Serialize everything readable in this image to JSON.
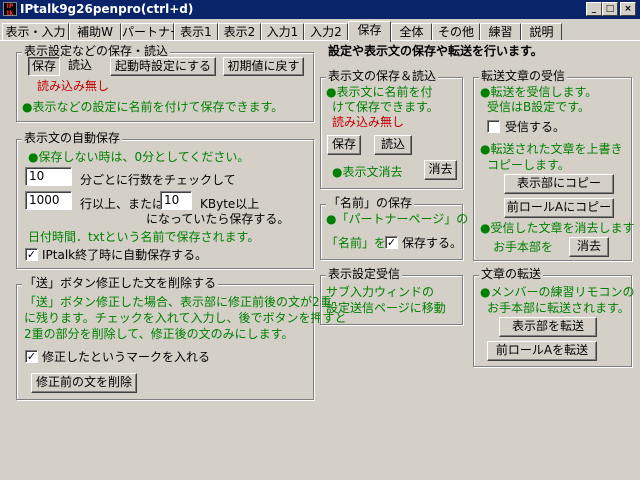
{
  "window": {
    "title": "IPtalk9g26penpro(ctrl+d)",
    "icon_label": "IPtalk"
  },
  "tabs": [
    "表示・入力",
    "補助W",
    "パートナー",
    "表示1",
    "表示2",
    "入力1",
    "入力2",
    "保存",
    "全体",
    "その他",
    "練習",
    "説明"
  ],
  "active_tab": "保存",
  "heading": "設定や表示文の保存や転送を行います。",
  "settings_save": {
    "title": "表示設定などの保存・読込",
    "save": "保存",
    "load": "読込",
    "startup": "起動時設定にする",
    "reset": "初期値に戻す",
    "status": "読み込み無し",
    "note": "●表示などの設定に名前を付けて保存できます。"
  },
  "autosave": {
    "title": "表示文の自動保存",
    "note1": "●保存しない時は、0分としてください。",
    "minutes": "10",
    "minutes_label": "分ごとに行数をチェックして",
    "lines": "1000",
    "lines_label": "行以上、または",
    "kbyte": "10",
    "kbyte_label": "KByte以上",
    "line3": "になっていたら保存する。",
    "note2": "日付時間．txtという名前で保存されます。",
    "on_exit": "IPtalk終了時に自動保存する。"
  },
  "send_fix": {
    "title": "「送」ボタン修正した文を削除する",
    "desc1": "「送」ボタン修正した場合、表示部に修正前後の文が2重",
    "desc2": "に残ります。チェックを入れて入力し、後でボタンを押すと",
    "desc3": "2重の部分を削除して、修正後の文のみにします。",
    "mark_label": "修正したというマークを入れる",
    "delete_button": "修正前の文を削除"
  },
  "text_save": {
    "title": "表示文の保存＆読込",
    "note1": "●表示文に名前を付",
    "note2": "けて保存できます。",
    "status": "読み込み無し",
    "save": "保存",
    "load": "読込",
    "clear_label": "●表示文消去",
    "clear": "消去"
  },
  "name_save": {
    "title": "「名前」の保存",
    "line1": "●「パートナーページ」の",
    "line2": "「名前」を",
    "check_label": "保存する。"
  },
  "display_recv": {
    "title": "表示設定受信",
    "line1": "サブ入力ウィンドの",
    "line2": "設定送信ページに移動"
  },
  "transfer_recv": {
    "title": "転送文章の受信",
    "note1": "●転送を受信します。",
    "note2": "受信はB設定です。",
    "recv_label": "受信する。",
    "note3": "●転送された文章を上書き",
    "note4": "コピーします。",
    "copy_display": "表示部にコピー",
    "copy_prev": "前ロールAにコピー",
    "note5": "●受信した文章を消去します",
    "note6": "お手本部を",
    "clear": "消去"
  },
  "text_transfer": {
    "title": "文章の転送",
    "note1": "●メンバーの練習リモコンの",
    "note2": "お手本部に転送されます。",
    "send_display": "表示部を転送",
    "send_prev": "前ロールAを転送"
  },
  "colors": {
    "titlebar": "#0a246a",
    "face": "#d4d0c8",
    "note_green": "#008000",
    "note_red": "#c00000"
  }
}
